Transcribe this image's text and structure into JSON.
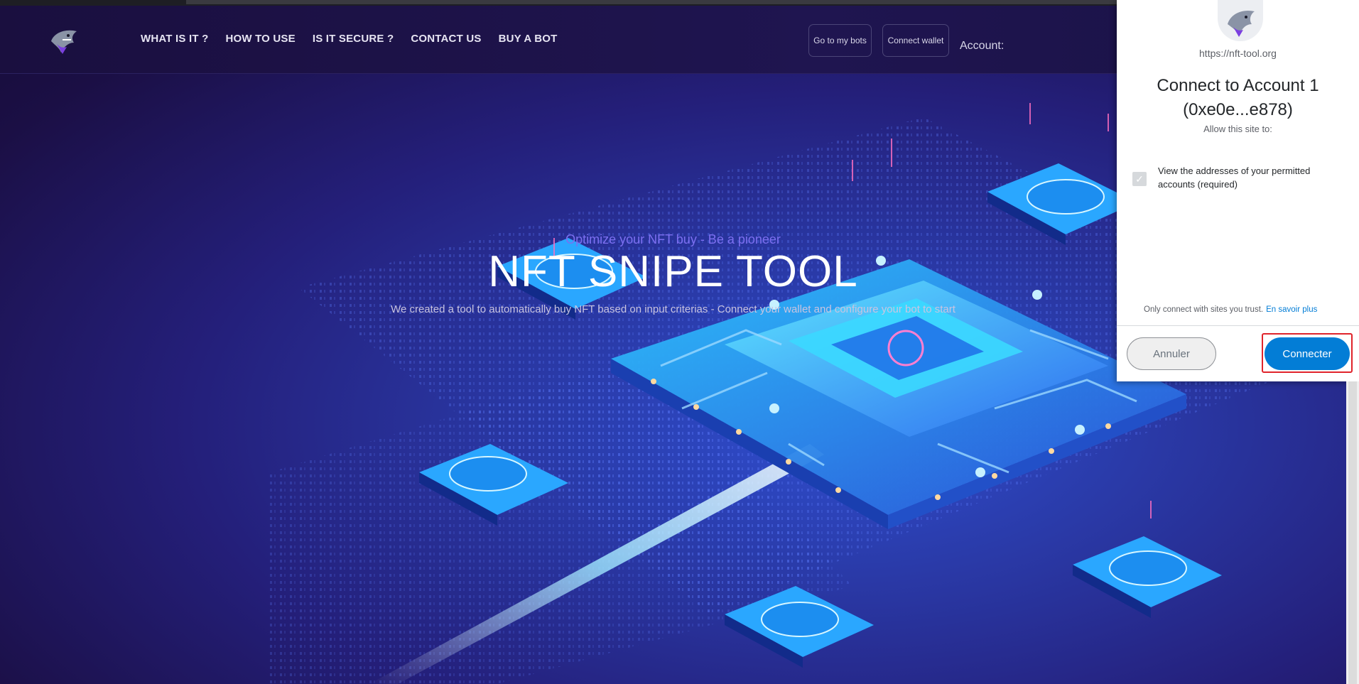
{
  "nav": {
    "links": [
      "WHAT IS IT ?",
      "HOW TO USE",
      "IS IT SECURE ?",
      "CONTACT US",
      "BUY A BOT"
    ],
    "go_to_bots": "Go to my bots",
    "connect_wallet": "Connect wallet",
    "account_label": "Account:"
  },
  "hero": {
    "subtitle": "Optimize your NFT buy - Be a pioneer",
    "title": "NFT SNIPE TOOL",
    "description": "We created a tool to automatically buy NFT based on input criterias - Connect your wallet and configure your bot to start"
  },
  "popup": {
    "origin": "https://nft-tool.org",
    "title_line1": "Connect to Account 1",
    "title_line2": "(0xe0e...e878)",
    "allow_text": "Allow this site to:",
    "permission": "View the addresses of your permitted accounts (required)",
    "trust_text": "Only connect with sites you trust.",
    "learn_more": "En savoir plus",
    "cancel_label": "Annuler",
    "connect_label": "Connecter"
  },
  "icons": {
    "logo": "shark-logo-icon",
    "avatar": "shark-avatar-icon",
    "check": "checkbox-check-icon"
  },
  "colors": {
    "accent": "#037dd6",
    "hero_subtitle": "#7c6ff0",
    "highlight": "#e0242b",
    "nav_bg": "#1f1550"
  }
}
